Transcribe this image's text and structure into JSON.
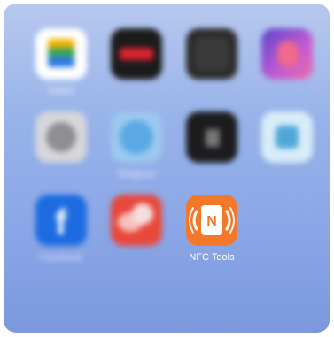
{
  "home_screen": {
    "apps": [
      {
        "label": "Wallet",
        "icon": "wallet-icon"
      },
      {
        "label": "",
        "icon": "video-app-icon"
      },
      {
        "label": "",
        "icon": "dark-app-icon"
      },
      {
        "label": "",
        "icon": "creative-app-icon"
      },
      {
        "label": "",
        "icon": "settings-icon"
      },
      {
        "label": "Telegram",
        "icon": "telegram-icon"
      },
      {
        "label": "",
        "icon": "dark-widget-icon"
      },
      {
        "label": "",
        "icon": "light-blue-app-icon"
      },
      {
        "label": "Facebook",
        "icon": "facebook-icon"
      },
      {
        "label": "",
        "icon": "red-app-icon"
      },
      {
        "label": "NFC Tools",
        "icon": "nfc-icon",
        "icon_letter": "N"
      }
    ]
  },
  "colors": {
    "nfc_orange": "#f4782a",
    "wallpaper_top": "#b7c8ee",
    "wallpaper_bottom": "#7b98de"
  }
}
